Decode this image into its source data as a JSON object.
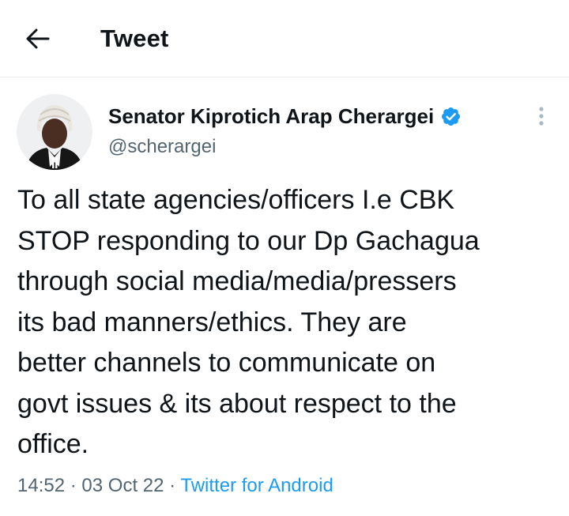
{
  "header": {
    "title": "Tweet",
    "back_icon": "arrow-left-icon"
  },
  "tweet": {
    "author": {
      "display_name": "Senator Kiprotich Arap Cherargei",
      "handle": "@scherargei",
      "verified": true,
      "verified_icon": "verified-badge-icon"
    },
    "text": "To all state agencies/officers I.e CBK\nSTOP responding to our Dp Gachagua\nthrough social media/media/pressers\nits bad manners/ethics. They are\nbetter channels to communicate on\ngovt issues & its about respect to the\noffice.",
    "time": "14:52",
    "separator": "·",
    "date": "03 Oct 22",
    "source": "Twitter for Android",
    "more_icon": "more-vertical-icon"
  },
  "colors": {
    "text_primary": "#0f1419",
    "text_secondary": "#536471",
    "accent": "#1d9bf0",
    "divider": "#e6ecf0"
  }
}
